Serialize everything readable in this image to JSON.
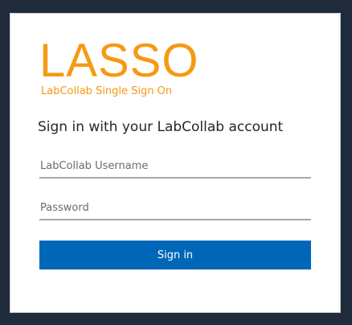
{
  "logo": {
    "word": "LASSO",
    "tagline": "LabCollab Single Sign On",
    "color": "#f59a12"
  },
  "heading": "Sign in with your LabCollab account",
  "form": {
    "username": {
      "placeholder": "LabCollab Username",
      "value": ""
    },
    "password": {
      "placeholder": "Password",
      "value": ""
    },
    "submit_label": "Sign in",
    "submit_color": "#0067b8"
  },
  "colors": {
    "background": "#1f2b3b",
    "card": "#ffffff"
  }
}
